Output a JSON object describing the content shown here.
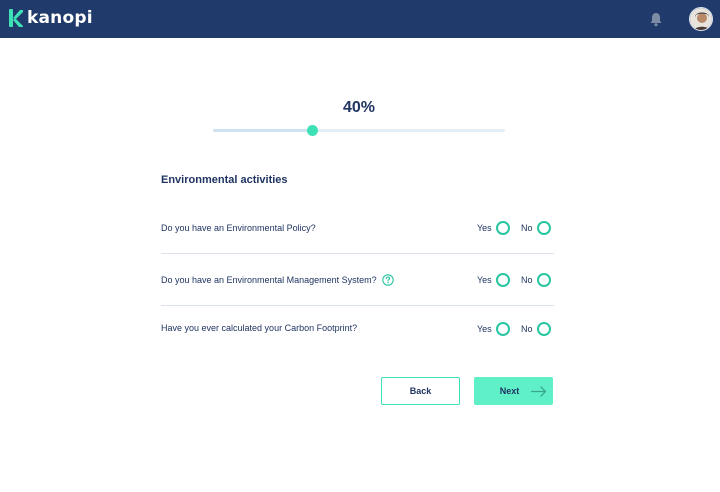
{
  "app": {
    "name": "kanopi"
  },
  "progress": {
    "label": "40%",
    "value": 0.34
  },
  "section": {
    "title": "Environmental activities"
  },
  "questions": [
    {
      "text": "Do you have an Environmental Policy?",
      "yes": "Yes",
      "no": "No"
    },
    {
      "text": "Do you have an Environmental Management System?",
      "yes": "Yes",
      "no": "No"
    },
    {
      "text": "Have you ever calculated your Carbon Footprint?",
      "yes": "Yes",
      "no": "No"
    }
  ],
  "buttons": {
    "back": "Back",
    "next": "Next"
  },
  "colors": {
    "header": "#1f3a6b",
    "accent": "#3ee0b5",
    "text": "#1f3462",
    "next_button": "#5ff0c7"
  },
  "icons": {
    "logo": "kanopi-k-logo",
    "bell": "bell-icon",
    "help": "question-mark-icon",
    "arrow": "arrow-right-icon",
    "avatar": "user-avatar"
  }
}
